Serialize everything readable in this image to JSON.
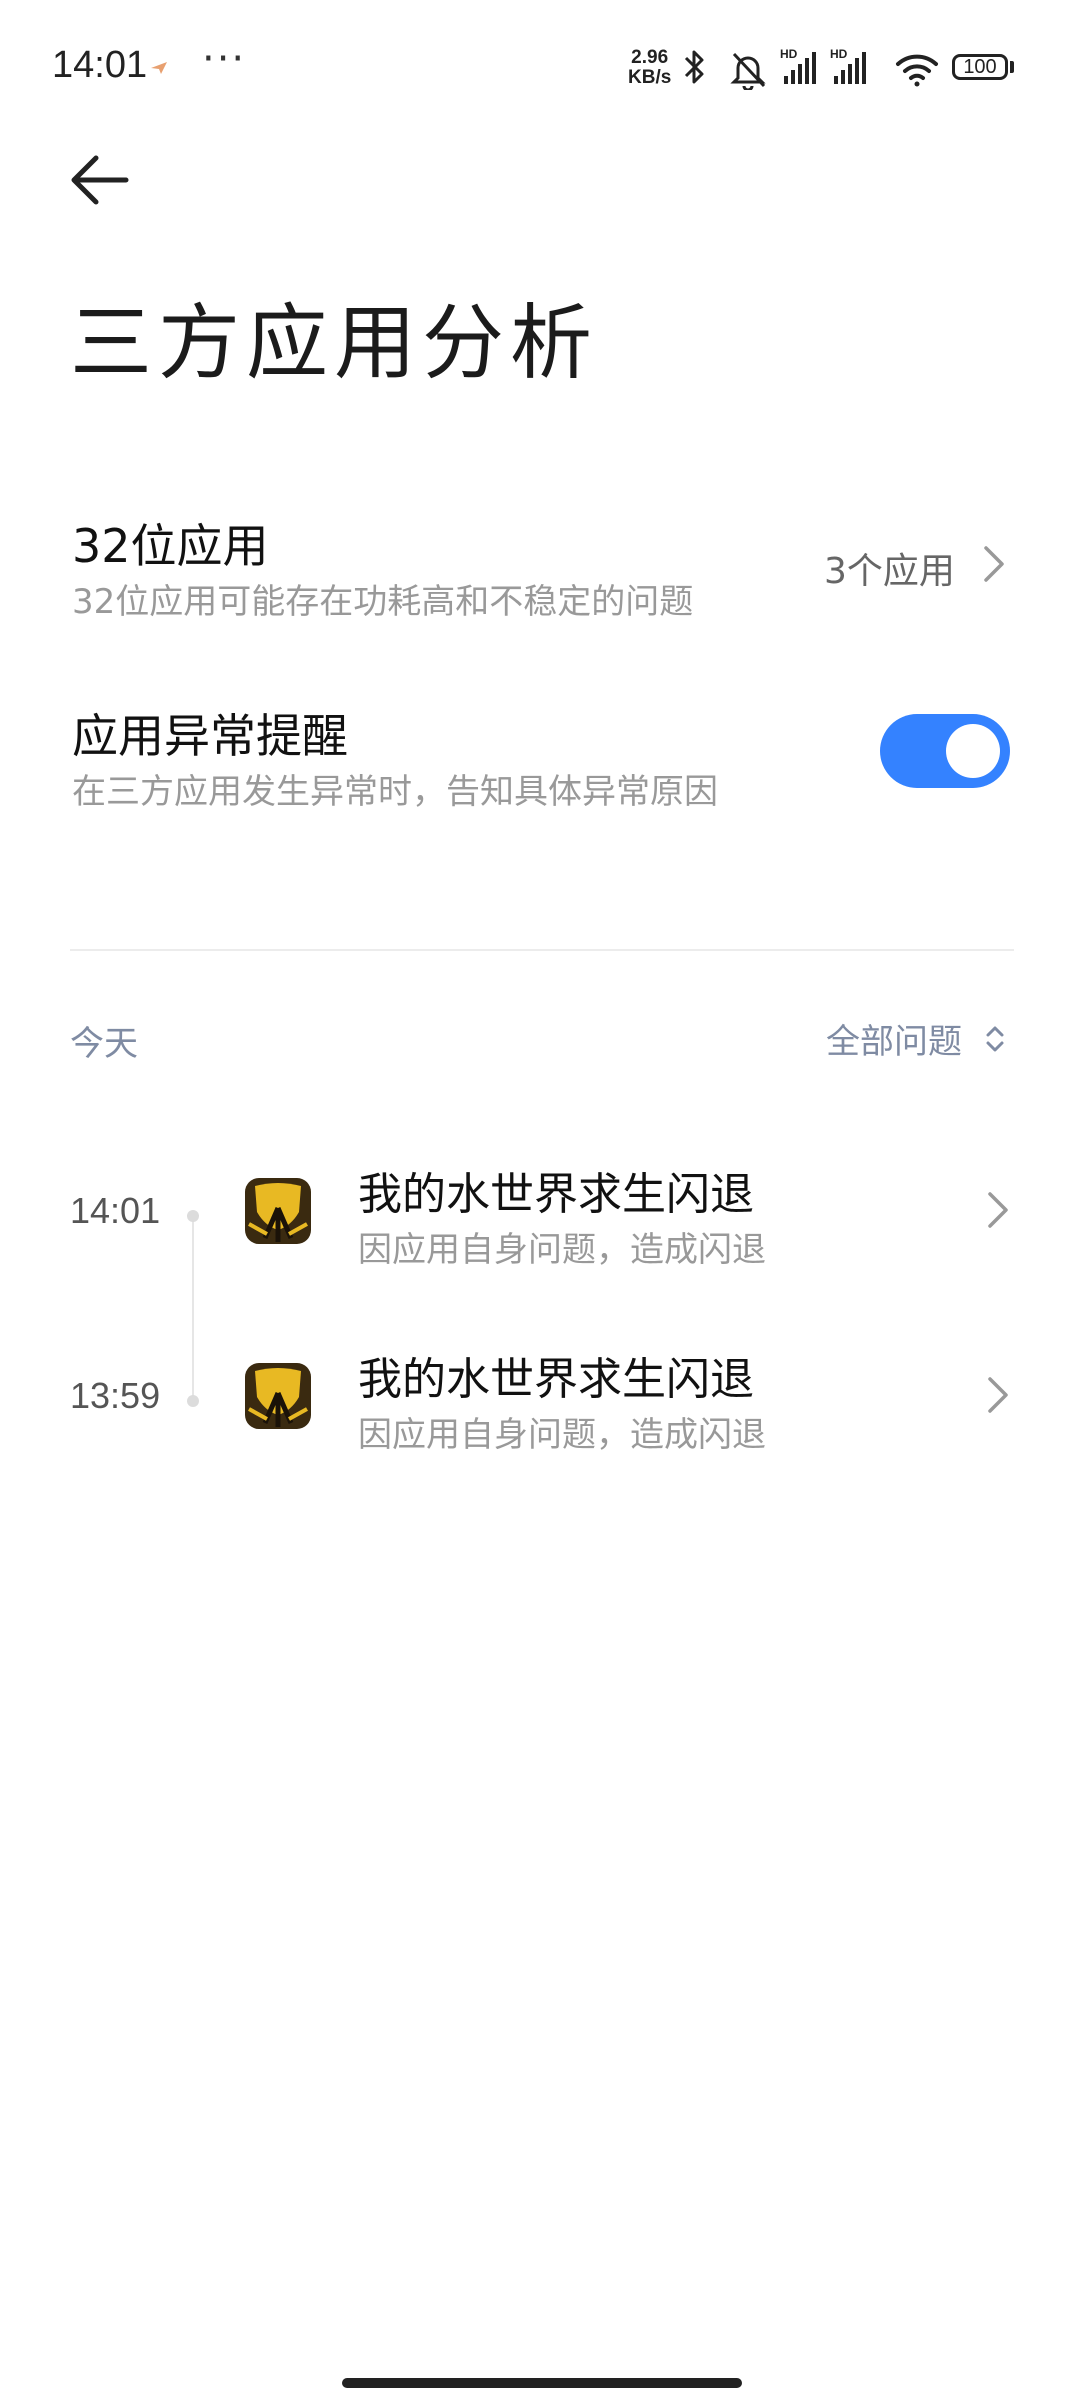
{
  "status_bar": {
    "time": "14:01",
    "more": "···",
    "net_speed_value": "2.96",
    "net_speed_unit": "KB/s",
    "battery": "100",
    "icons": [
      "location-icon",
      "bluetooth-icon",
      "bell-muted-icon",
      "signal-hd-icon",
      "signal-hd-icon",
      "wifi-icon",
      "battery-icon"
    ]
  },
  "header": {
    "title": "三方应用分析"
  },
  "settings": {
    "app32": {
      "title": "32位应用",
      "subtitle": "32位应用可能存在功耗高和不稳定的问题",
      "value": "3个应用"
    },
    "anomaly_alert": {
      "title": "应用异常提醒",
      "subtitle": "在三方应用发生异常时，告知具体异常原因",
      "enabled": true
    }
  },
  "events": {
    "section_label": "今天",
    "filter_label": "全部问题",
    "items": [
      {
        "time": "14:01",
        "title": "我的水世界求生闪退",
        "subtitle": "因应用自身问题，造成闪退"
      },
      {
        "time": "13:59",
        "title": "我的水世界求生闪退",
        "subtitle": "因应用自身问题，造成闪退"
      }
    ]
  },
  "colors": {
    "accent": "#3482ff",
    "secondary_text": "#999999",
    "section_text": "#7f8ba3",
    "icon_gold": "#e8b923",
    "icon_dark": "#3a2a10"
  }
}
